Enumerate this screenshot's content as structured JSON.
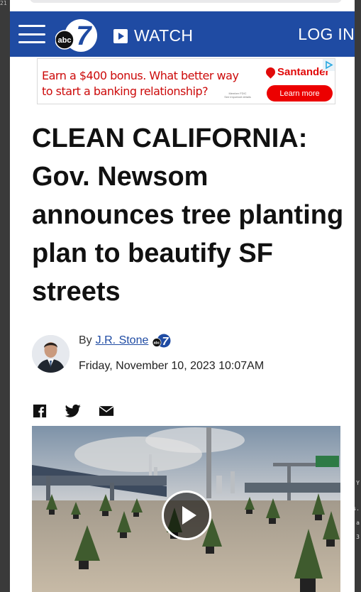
{
  "header": {
    "menu_icon": "hamburger-icon",
    "logo_text": "abc",
    "logo_number": "7",
    "watch_label": "WATCH",
    "watch_icon": "play-square-icon",
    "login_label": "LOG IN",
    "brand_color": "#1f4ba3"
  },
  "ad": {
    "text_line1": "Earn a $400 bonus. What better way",
    "text_line2": "to start a banking relationship?",
    "brand": "Santander",
    "disclaimer_line1": "Member FDIC",
    "disclaimer_line2": "See important details",
    "cta": "Learn more",
    "accent_color": "#ec0000",
    "adchoices_icon": "adchoices-icon"
  },
  "article": {
    "headline": "CLEAN CALIFORNIA: Gov. Newsom announces tree planting plan to beautify SF streets",
    "by_prefix": "By",
    "author": "J.R. Stone",
    "station_logo_text": "abc",
    "station_logo_number": "7",
    "date": "Friday, November 10, 2023 10:07AM"
  },
  "share": {
    "icons": [
      "facebook-icon",
      "twitter-icon",
      "email-icon"
    ]
  },
  "video": {
    "play_icon": "play-icon"
  },
  "backdrop": {
    "corner_text": "21",
    "right_hints": [
      "Y",
      "s.",
      "a",
      "3"
    ]
  }
}
